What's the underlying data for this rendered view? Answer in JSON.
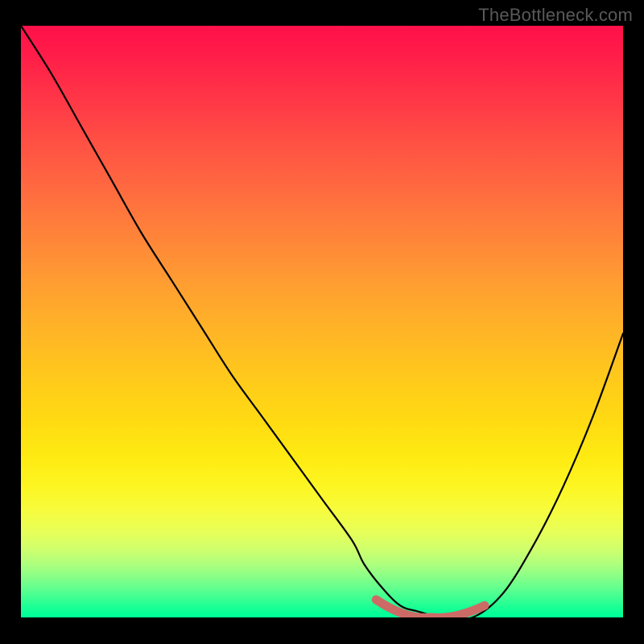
{
  "watermark": "TheBottleneck.com",
  "colors": {
    "accent_marker": "#cc6b66",
    "curve": "#000000",
    "frame": "#000000"
  },
  "chart_data": {
    "type": "line",
    "title": "",
    "xlabel": "",
    "ylabel": "",
    "xlim": [
      0,
      100
    ],
    "ylim": [
      0,
      100
    ],
    "grid": false,
    "x": [
      0,
      5,
      10,
      15,
      20,
      25,
      30,
      35,
      40,
      45,
      50,
      55,
      57,
      60,
      63,
      66,
      70,
      75,
      80,
      85,
      90,
      95,
      100
    ],
    "values": [
      100,
      92,
      83,
      74,
      65,
      57,
      49,
      41,
      34,
      27,
      20,
      13,
      9,
      5,
      2,
      1,
      0,
      0,
      4,
      12,
      22,
      34,
      48
    ],
    "optimal_range": {
      "x_start": 59,
      "x_end": 77,
      "y_start": 3,
      "y_mid": 0,
      "y_end": 2
    },
    "annotations": []
  }
}
